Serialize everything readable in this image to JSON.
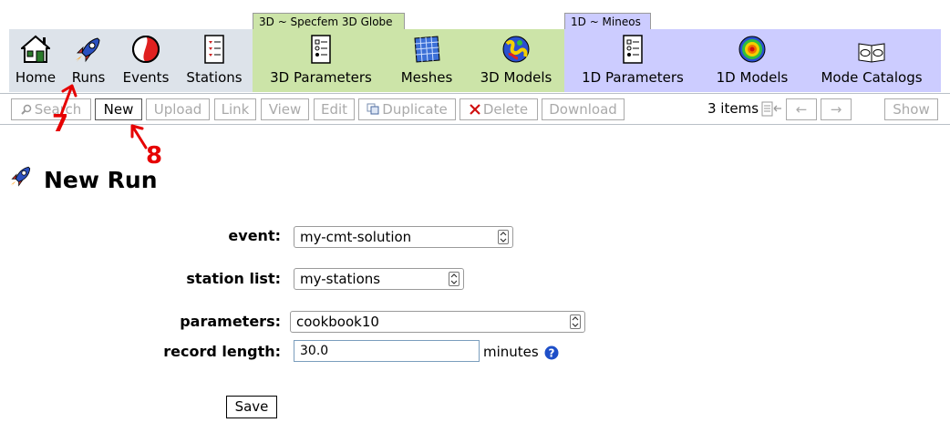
{
  "nav": {
    "groups": {
      "specfem": "3D ~ Specfem 3D Globe",
      "mineos": "1D ~ Mineos"
    },
    "items": [
      {
        "label": "Home",
        "icon": "house-icon"
      },
      {
        "label": "Runs",
        "icon": "rocket-icon"
      },
      {
        "label": "Events",
        "icon": "beachball-icon"
      },
      {
        "label": "Stations",
        "icon": "list-checkbox-icon"
      },
      {
        "label": "3D Parameters",
        "icon": "parameters-form-icon"
      },
      {
        "label": "Meshes",
        "icon": "mesh-grid-icon"
      },
      {
        "label": "3D Models",
        "icon": "earth-model-icon"
      },
      {
        "label": "1D Parameters",
        "icon": "parameters-form-icon"
      },
      {
        "label": "1D Models",
        "icon": "radial-model-icon"
      },
      {
        "label": "Mode Catalogs",
        "icon": "mode-catalog-icon"
      }
    ],
    "colors": {
      "nav_blue": "#dde3ea",
      "specfem_green": "#cce4a8",
      "mineos_purple": "#ccccff"
    }
  },
  "toolbar": {
    "search": "Search",
    "new": "New",
    "upload": "Upload",
    "link": "Link",
    "view": "View",
    "edit": "Edit",
    "duplicate": "Duplicate",
    "delete": "Delete",
    "download": "Download",
    "items_count": "3 items",
    "prev": "←",
    "next": "→",
    "show": "Show"
  },
  "annotations": {
    "runs_step": "7",
    "new_step": "8",
    "color": "#e60000"
  },
  "page": {
    "title": "New Run"
  },
  "form": {
    "event_label": "event:",
    "event_value": "my-cmt-solution",
    "station_label": "station list:",
    "station_value": "my-stations",
    "parameters_label": "parameters:",
    "parameters_value": "cookbook10",
    "record_label": "record length:",
    "record_value": "30.0",
    "record_unit": "minutes",
    "save": "Save"
  }
}
